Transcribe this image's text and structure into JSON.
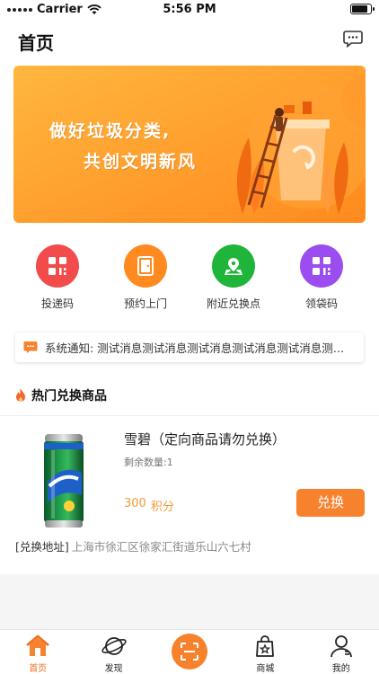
{
  "status_bar": {
    "carrier": "Carrier",
    "time": "5:56 PM",
    "battery_level": 0.9
  },
  "nav": {
    "title": "首页",
    "message_icon": "message-icon"
  },
  "banner": {
    "line1": "做好垃圾分类,",
    "line2": "共创文明新风",
    "colors": {
      "start": "#ffb23c",
      "end": "#ff8a1e"
    }
  },
  "quick_menu": [
    {
      "label": "投递码",
      "icon": "qr-code-icon",
      "color": "#f24b4b"
    },
    {
      "label": "预约上门",
      "icon": "door-icon",
      "color": "#ff8a1f"
    },
    {
      "label": "附近兑换点",
      "icon": "map-pin-icon",
      "color": "#1fb43a"
    },
    {
      "label": "领袋码",
      "icon": "qr-code-icon",
      "color": "#9b4df0"
    }
  ],
  "notice": {
    "label": "系统通知: ",
    "text": "测试消息测试消息测试消息测试消息测试消息测试消息"
  },
  "hot_section": {
    "title": "热门兑换商品",
    "icon": "fire-icon"
  },
  "product": {
    "name": "雪碧（定向商品请勿兑换）",
    "stock_label": "剩余数量:",
    "stock_value": "1",
    "points_value": "300",
    "points_unit": "积分",
    "button_label": "兑换",
    "address_label": "[兑换地址]",
    "address": "上海市徐汇区徐家汇街道乐山六七村"
  },
  "tabbar": [
    {
      "label": "首页",
      "icon": "home-icon",
      "active": true
    },
    {
      "label": "发现",
      "icon": "planet-icon",
      "active": false
    },
    {
      "label": "",
      "icon": "scan-icon",
      "active": false
    },
    {
      "label": "商城",
      "icon": "shop-bag-icon",
      "active": false
    },
    {
      "label": "我的",
      "icon": "user-icon",
      "active": false
    }
  ],
  "accent_color": "#f7822e"
}
